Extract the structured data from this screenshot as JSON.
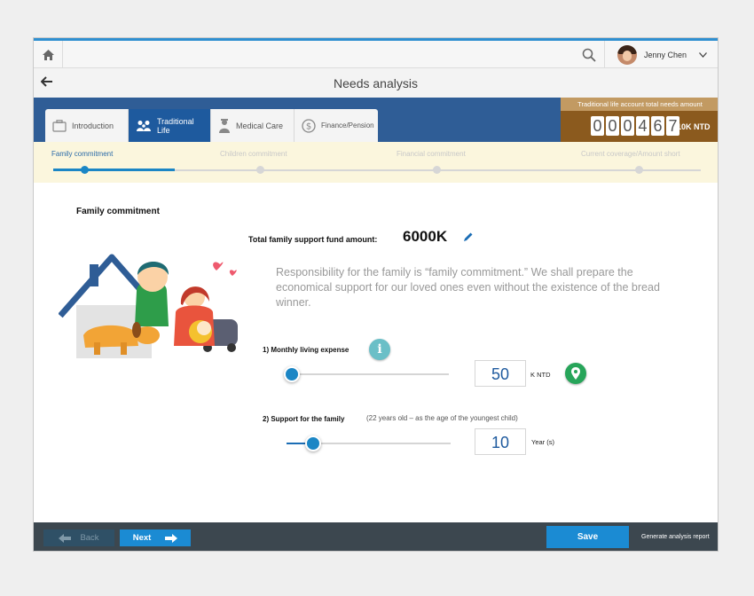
{
  "header": {
    "user_name": "Jenny Chen"
  },
  "page": {
    "title": "Needs analysis"
  },
  "tabs": [
    {
      "label": "Introduction",
      "icon": "briefcase-icon"
    },
    {
      "label": "Traditional Life",
      "icon": "family-icon"
    },
    {
      "label": "Medical Care",
      "icon": "doctor-icon"
    },
    {
      "label": "Finance/Pension",
      "icon": "dollar-coin-icon"
    }
  ],
  "counter": {
    "label": "Traditional life account total needs amount",
    "digits": [
      "0",
      "0",
      "0",
      "4",
      "6",
      "7"
    ],
    "unit": "10K NTD"
  },
  "steps": [
    {
      "label": "Family commitment"
    },
    {
      "label": "Children commitment"
    },
    {
      "label": "Financial commitment"
    },
    {
      "label": "Current coverage/Amount short"
    }
  ],
  "main": {
    "section_title": "Family commitment",
    "fund_label": "Total family support fund amount:",
    "fund_value": "6000K",
    "description": "Responsibility for the family is “family commitment.” We shall prepare the economical support for our loved ones even without the existence of the bread winner.",
    "q1": {
      "label": "1) Monthly living expense",
      "value": "50",
      "unit": "K NTD",
      "slider_fraction": 0.0
    },
    "q2": {
      "label": "2) Support for the family",
      "note": "(22 years old – as the age of the youngest child)",
      "value": "10",
      "unit": "Year (s)",
      "slider_fraction": 0.16
    }
  },
  "footer": {
    "back_label": "Back",
    "next_label": "Next",
    "save_label": "Save",
    "report_label": "Generate analysis report"
  },
  "colors": {
    "accent": "#1b86c5",
    "tab_band": "#2f5d96",
    "counter_bg": "#8b5a1e",
    "footer_bg": "#3c474f",
    "pin_green": "#27a55a",
    "info_teal": "#6bbfc7"
  }
}
